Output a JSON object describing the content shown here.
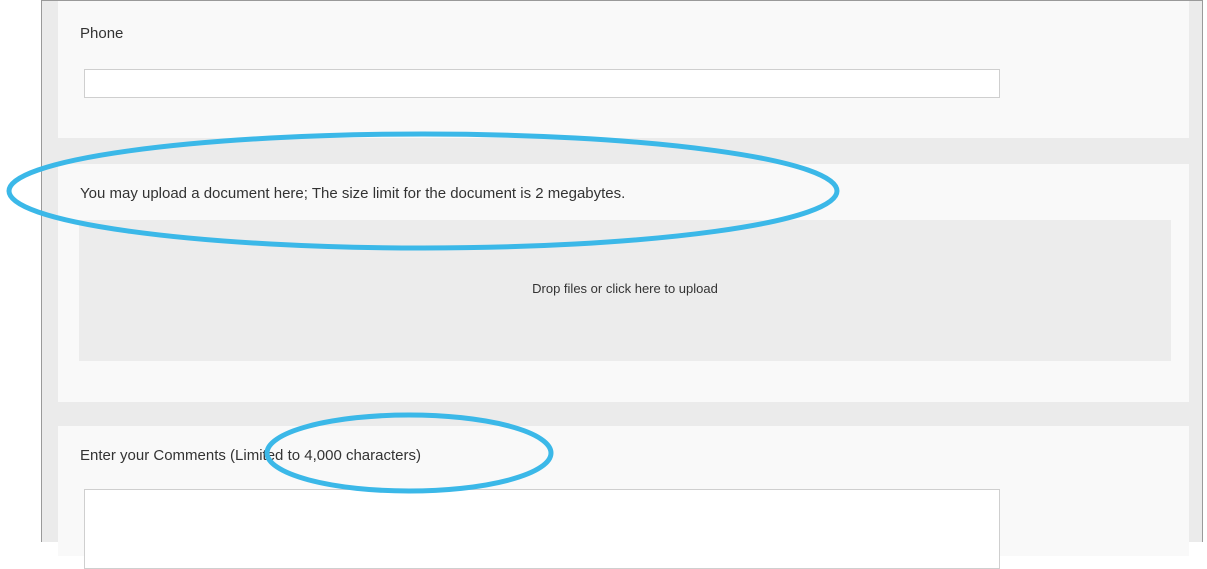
{
  "phone": {
    "label": "Phone",
    "value": "",
    "placeholder": ""
  },
  "upload": {
    "label": "You may upload a document here; The size limit for the document is 2 megabytes.",
    "dropzone_text": "Drop files or click here to upload"
  },
  "comments": {
    "label": "Enter your Comments (Limited to 4,000 characters)",
    "value": ""
  },
  "colors": {
    "annotation": "#3bb8e8",
    "panel_bg": "#f9f9f9",
    "page_bg": "#ebebeb",
    "dropzone_bg": "#ececec"
  }
}
